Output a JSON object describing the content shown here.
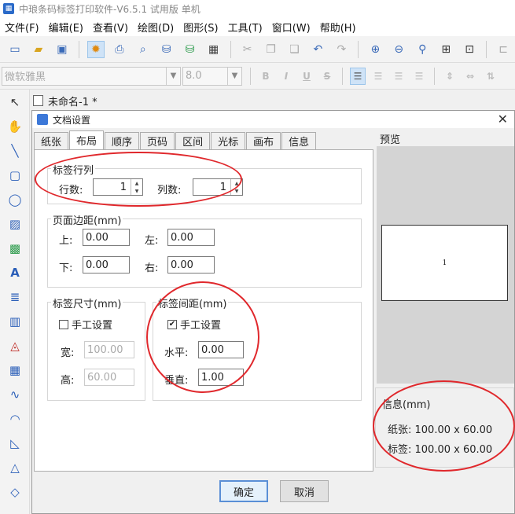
{
  "app": {
    "title": "中琅条码标签打印软件-V6.5.1 试用版 单机"
  },
  "menu": [
    "文件(F)",
    "编辑(E)",
    "查看(V)",
    "绘图(D)",
    "图形(S)",
    "工具(T)",
    "窗口(W)",
    "帮助(H)"
  ],
  "toolbar": {
    "icons": [
      "new-icon",
      "open-icon",
      "save-icon",
      "settings-icon",
      "print-icon",
      "print-preview-icon",
      "database-icon",
      "database-link-icon",
      "grid-icon",
      "cut-icon",
      "copy-icon",
      "paste-icon",
      "undo-icon",
      "redo-icon",
      "zoom-in-icon",
      "zoom-out-icon",
      "zoom-icon",
      "fit-page-icon",
      "fit-width-icon",
      "align-icon"
    ]
  },
  "fontbar": {
    "font_name": "微软雅黑",
    "font_size": "8.0",
    "bold": "B",
    "italic": "I",
    "underline": "U",
    "strike": "S"
  },
  "document": {
    "tab_label": "未命名-1 *"
  },
  "dialog": {
    "title": "文档设置",
    "tabs": [
      "纸张",
      "布局",
      "顺序",
      "页码",
      "区间",
      "光标",
      "画布",
      "信息"
    ],
    "selected_tab": "布局",
    "rows_cols": {
      "title": "标签行列",
      "rows_label": "行数:",
      "rows_value": "1",
      "cols_label": "列数:",
      "cols_value": "1"
    },
    "margins": {
      "title": "页面边距(mm)",
      "top_label": "上:",
      "top_value": "0.00",
      "left_label": "左:",
      "left_value": "0.00",
      "bottom_label": "下:",
      "bottom_value": "0.00",
      "right_label": "右:",
      "right_value": "0.00"
    },
    "label_size": {
      "title": "标签尺寸(mm)",
      "manual_label": "手工设置",
      "manual_checked": false,
      "width_label": "宽:",
      "width_value": "100.00",
      "height_label": "高:",
      "height_value": "60.00"
    },
    "label_gap": {
      "title": "标签间距(mm)",
      "manual_label": "手工设置",
      "manual_checked": true,
      "h_label": "水平:",
      "h_value": "0.00",
      "v_label": "垂直:",
      "v_value": "1.00"
    },
    "preview": {
      "title": "预览",
      "label_text": "1"
    },
    "info": {
      "title": "信息(mm)",
      "paper_line": "纸张: 100.00 x 60.00",
      "label_line": "标签: 100.00 x 60.00"
    },
    "ok_label": "确定",
    "cancel_label": "取消"
  },
  "annotation_color": "#e0282c"
}
